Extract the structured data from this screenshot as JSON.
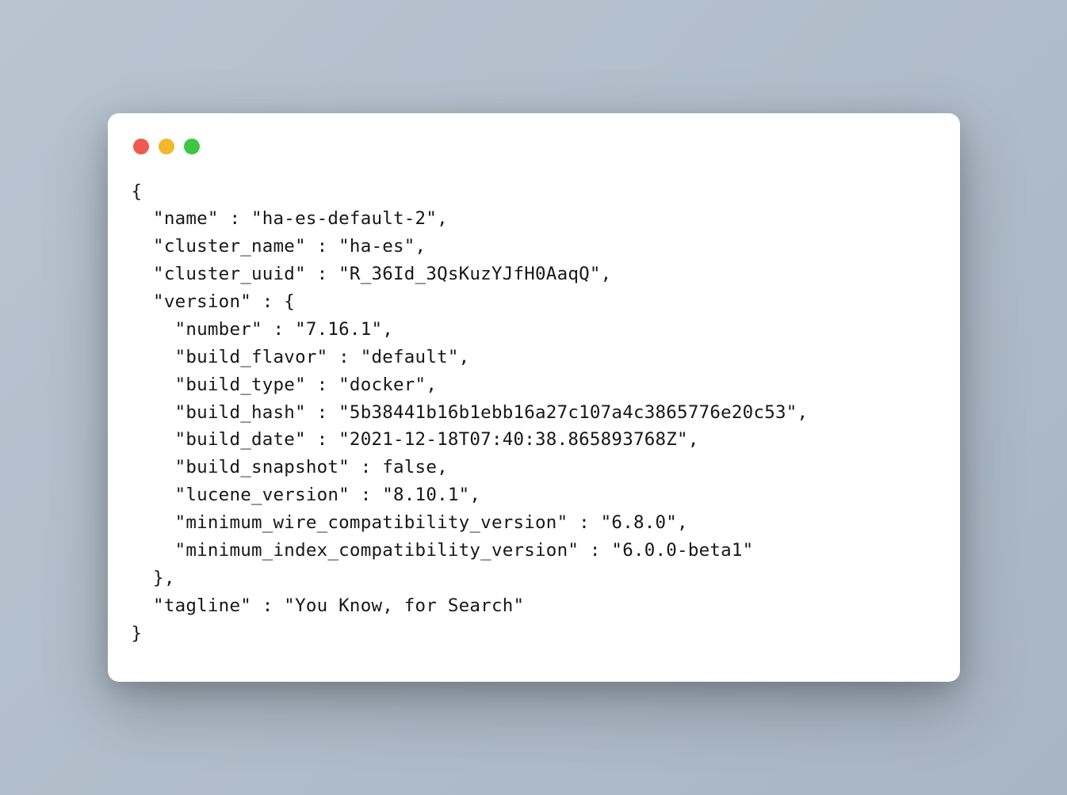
{
  "window": {
    "close_label": "Close",
    "minimize_label": "Minimize",
    "maximize_label": "Maximize"
  },
  "code_lines": {
    "l0": "{",
    "l1": "  \"name\" : \"ha-es-default-2\",",
    "l2": "  \"cluster_name\" : \"ha-es\",",
    "l3": "  \"cluster_uuid\" : \"R_36Id_3QsKuzYJfH0AaqQ\",",
    "l4": "  \"version\" : {",
    "l5": "    \"number\" : \"7.16.1\",",
    "l6": "    \"build_flavor\" : \"default\",",
    "l7": "    \"build_type\" : \"docker\",",
    "l8": "    \"build_hash\" : \"5b38441b16b1ebb16a27c107a4c3865776e20c53\",",
    "l9": "    \"build_date\" : \"2021-12-18T07:40:38.865893768Z\",",
    "l10": "    \"build_snapshot\" : false,",
    "l11": "    \"lucene_version\" : \"8.10.1\",",
    "l12": "    \"minimum_wire_compatibility_version\" : \"6.8.0\",",
    "l13": "    \"minimum_index_compatibility_version\" : \"6.0.0-beta1\"",
    "l14": "  },",
    "l15": "  \"tagline\" : \"You Know, for Search\"",
    "l16": "}"
  }
}
